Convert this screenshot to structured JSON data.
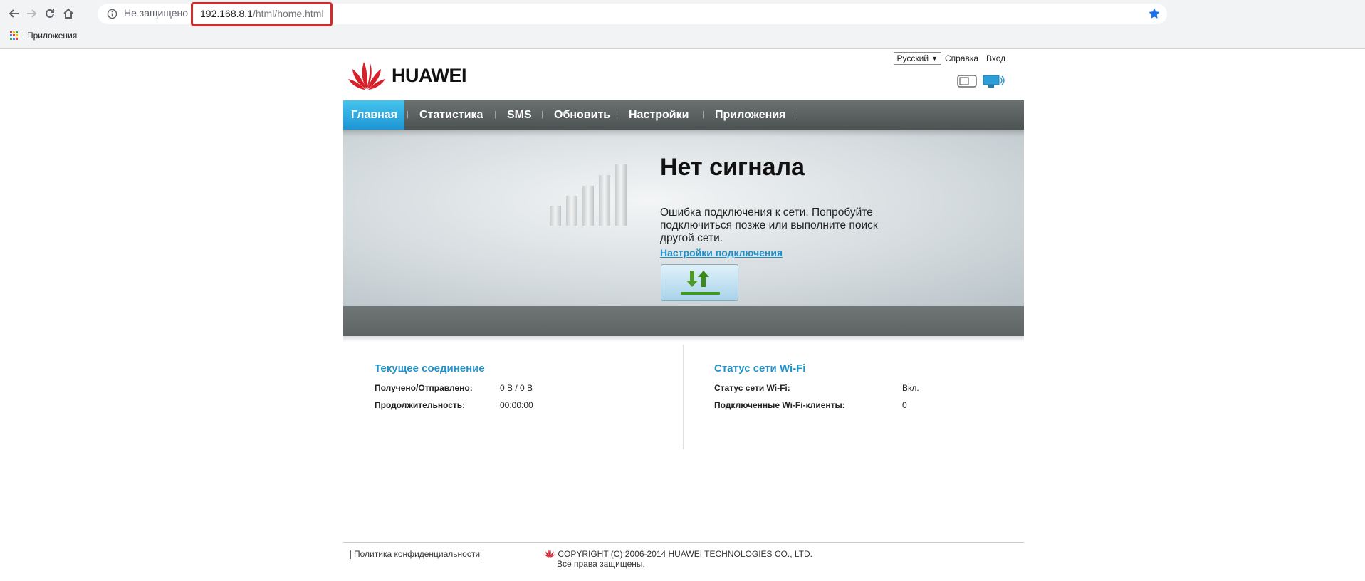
{
  "browser": {
    "security_label": "Не защищено",
    "url_host": "192.168.8.1",
    "url_path": "/html/home.html",
    "bookmarks_label": "Приложения",
    "url_highlight_color": "#d42a2a"
  },
  "header": {
    "language": "Русский",
    "help_link": "Справка",
    "login_link": "Вход",
    "logo_text": "HUAWEI"
  },
  "menu": {
    "items": [
      {
        "label": "Главная",
        "active": true
      },
      {
        "label": "Статистика",
        "active": false
      },
      {
        "label": "SMS",
        "active": false
      },
      {
        "label": "Обновить",
        "active": false
      },
      {
        "label": "Настройки",
        "active": false
      },
      {
        "label": "Приложения",
        "active": false
      }
    ],
    "active_color": "#1e95d4"
  },
  "status": {
    "title": "Нет сигнала",
    "message": "Ошибка подключения к сети. Попробуйте подключиться позже или выполните поиск другой сети.",
    "settings_link": "Настройки подключения",
    "signal_bars_active": 0
  },
  "current_connection": {
    "title": "Текущее соединение",
    "rows": [
      {
        "label": "Получено/Отправлено:",
        "value": "0 B /  0 B"
      },
      {
        "label": "Продолжительность:",
        "value": "00:00:00"
      }
    ]
  },
  "wifi_status": {
    "title": "Статус сети Wi-Fi",
    "rows": [
      {
        "label": "Статус сети Wi-Fi:",
        "value": "Вкл."
      },
      {
        "label": "Подключенные Wi-Fi-клиенты:",
        "value": "0"
      }
    ]
  },
  "footer": {
    "privacy": "Политика конфиденциальности",
    "copyright": "COPYRIGHT (C) 2006-2014 HUAWEI TECHNOLOGIES CO., LTD.",
    "rights": "Все права защищены."
  },
  "colors": {
    "accent_blue": "#2293c9",
    "huawei_red": "#d8202a"
  }
}
